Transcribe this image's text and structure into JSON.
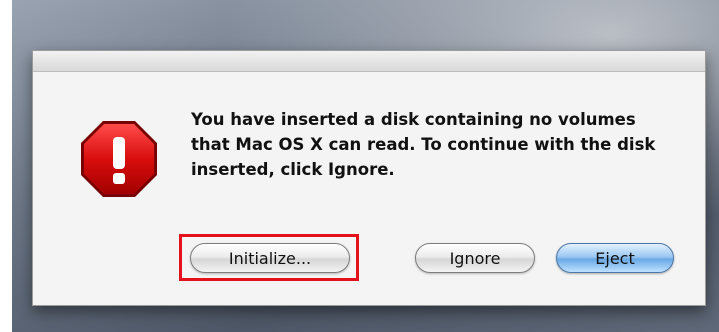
{
  "dialog": {
    "message": "You have inserted a disk containing no volumes that Mac OS X can read.  To continue with the disk inserted, click Ignore.",
    "icon": "stop-icon",
    "buttons": {
      "initialize_label": "Initialize...",
      "ignore_label": "Ignore",
      "eject_label": "Eject"
    }
  },
  "colors": {
    "stop_red": "#d90d0d",
    "highlight_red": "#e4101c",
    "default_button_blue": "#6aa9e6"
  }
}
